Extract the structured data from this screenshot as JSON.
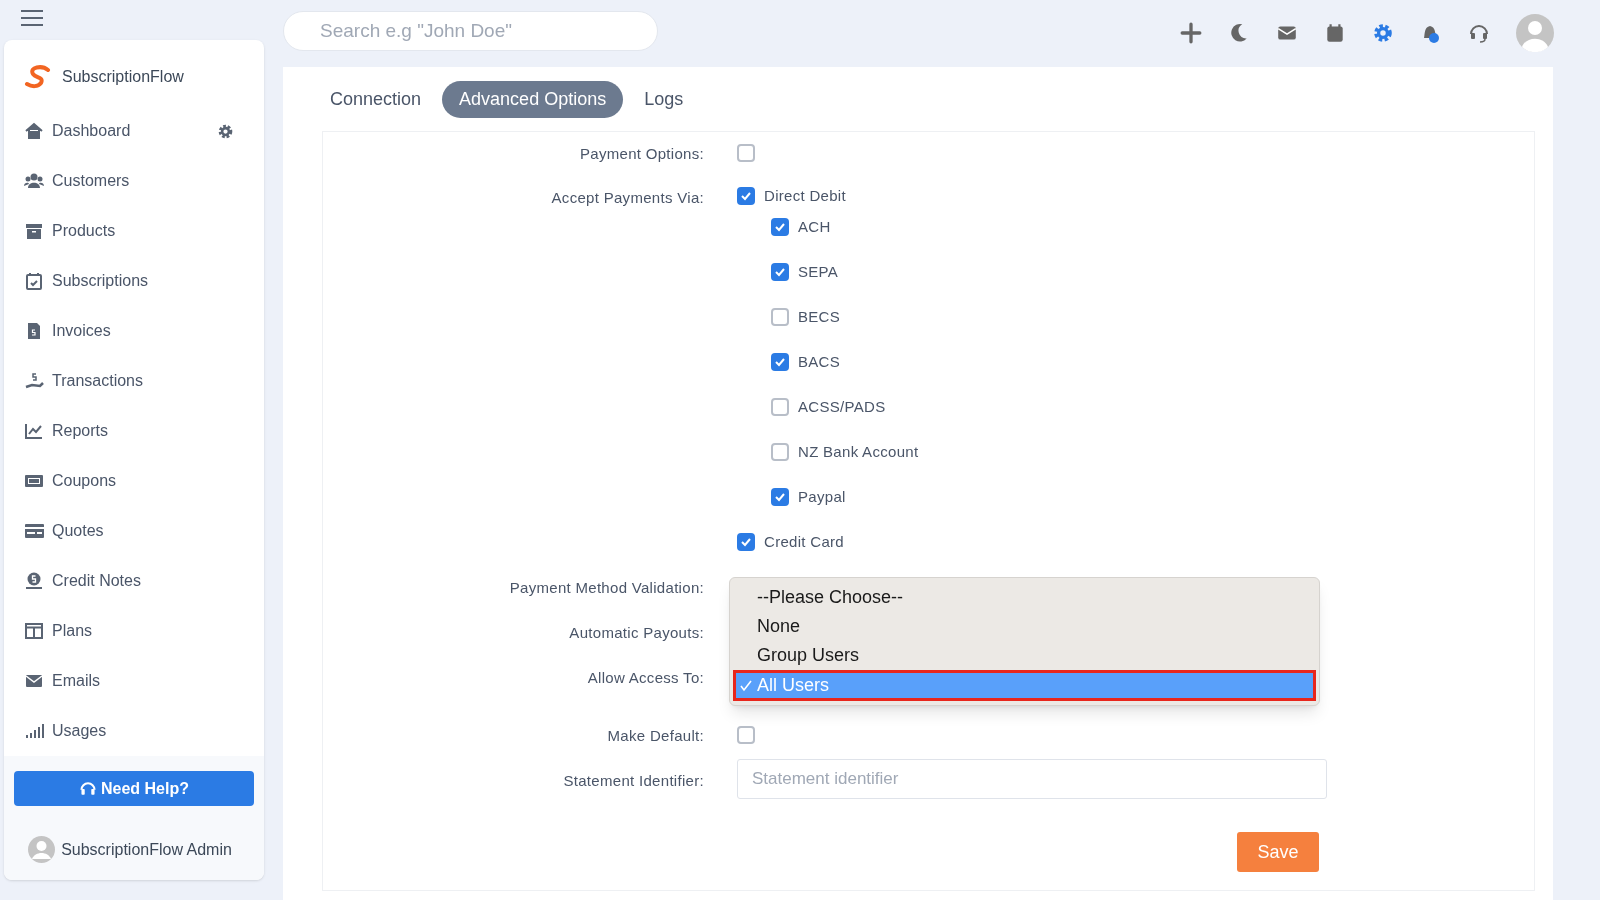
{
  "search": {
    "placeholder": "Search e.g \"John Doe\""
  },
  "sidebar": {
    "brand": "SubscriptionFlow",
    "items": [
      {
        "label": "Dashboard",
        "settings": true
      },
      {
        "label": "Customers",
        "settings": false
      },
      {
        "label": "Products",
        "settings": false
      },
      {
        "label": "Subscriptions",
        "settings": false
      },
      {
        "label": "Invoices",
        "settings": false
      },
      {
        "label": "Transactions",
        "settings": false
      },
      {
        "label": "Reports",
        "settings": false
      },
      {
        "label": "Coupons",
        "settings": false
      },
      {
        "label": "Quotes",
        "settings": false
      },
      {
        "label": "Credit Notes",
        "settings": false
      },
      {
        "label": "Plans",
        "settings": false
      },
      {
        "label": "Emails",
        "settings": false
      },
      {
        "label": "Usages",
        "settings": false
      }
    ],
    "help_button": "Need Help?",
    "user": "SubscriptionFlow Admin"
  },
  "tabs": [
    {
      "label": "Connection",
      "selected": false
    },
    {
      "label": "Advanced Options",
      "selected": true
    },
    {
      "label": "Logs",
      "selected": false
    }
  ],
  "form": {
    "payment_options": {
      "label": "Payment Options:",
      "checked": false
    },
    "accept_payments": {
      "label": "Accept Payments Via:",
      "methods": [
        {
          "label": "Direct Debit",
          "checked": true,
          "children": [
            {
              "label": "ACH",
              "checked": true
            },
            {
              "label": "SEPA",
              "checked": true
            },
            {
              "label": "BECS",
              "checked": false
            },
            {
              "label": "BACS",
              "checked": true
            },
            {
              "label": "ACSS/PADS",
              "checked": false
            },
            {
              "label": "NZ Bank Account",
              "checked": false
            },
            {
              "label": "Paypal",
              "checked": true
            }
          ]
        },
        {
          "label": "Credit Card",
          "checked": true
        }
      ]
    },
    "select_labels": [
      "Payment Method Validation:",
      "Automatic Payouts:",
      "Allow Access To:"
    ],
    "dropdown": {
      "options": [
        {
          "label": "--Please Choose--",
          "selected": false
        },
        {
          "label": "None",
          "selected": false
        },
        {
          "label": "Group Users",
          "selected": false
        },
        {
          "label": "All Users",
          "selected": true
        }
      ]
    },
    "make_default": {
      "label": "Make Default:",
      "checked": false
    },
    "statement_identifier": {
      "label": "Statement Identifier:",
      "placeholder": "Statement identifier"
    },
    "save_button": "Save"
  }
}
